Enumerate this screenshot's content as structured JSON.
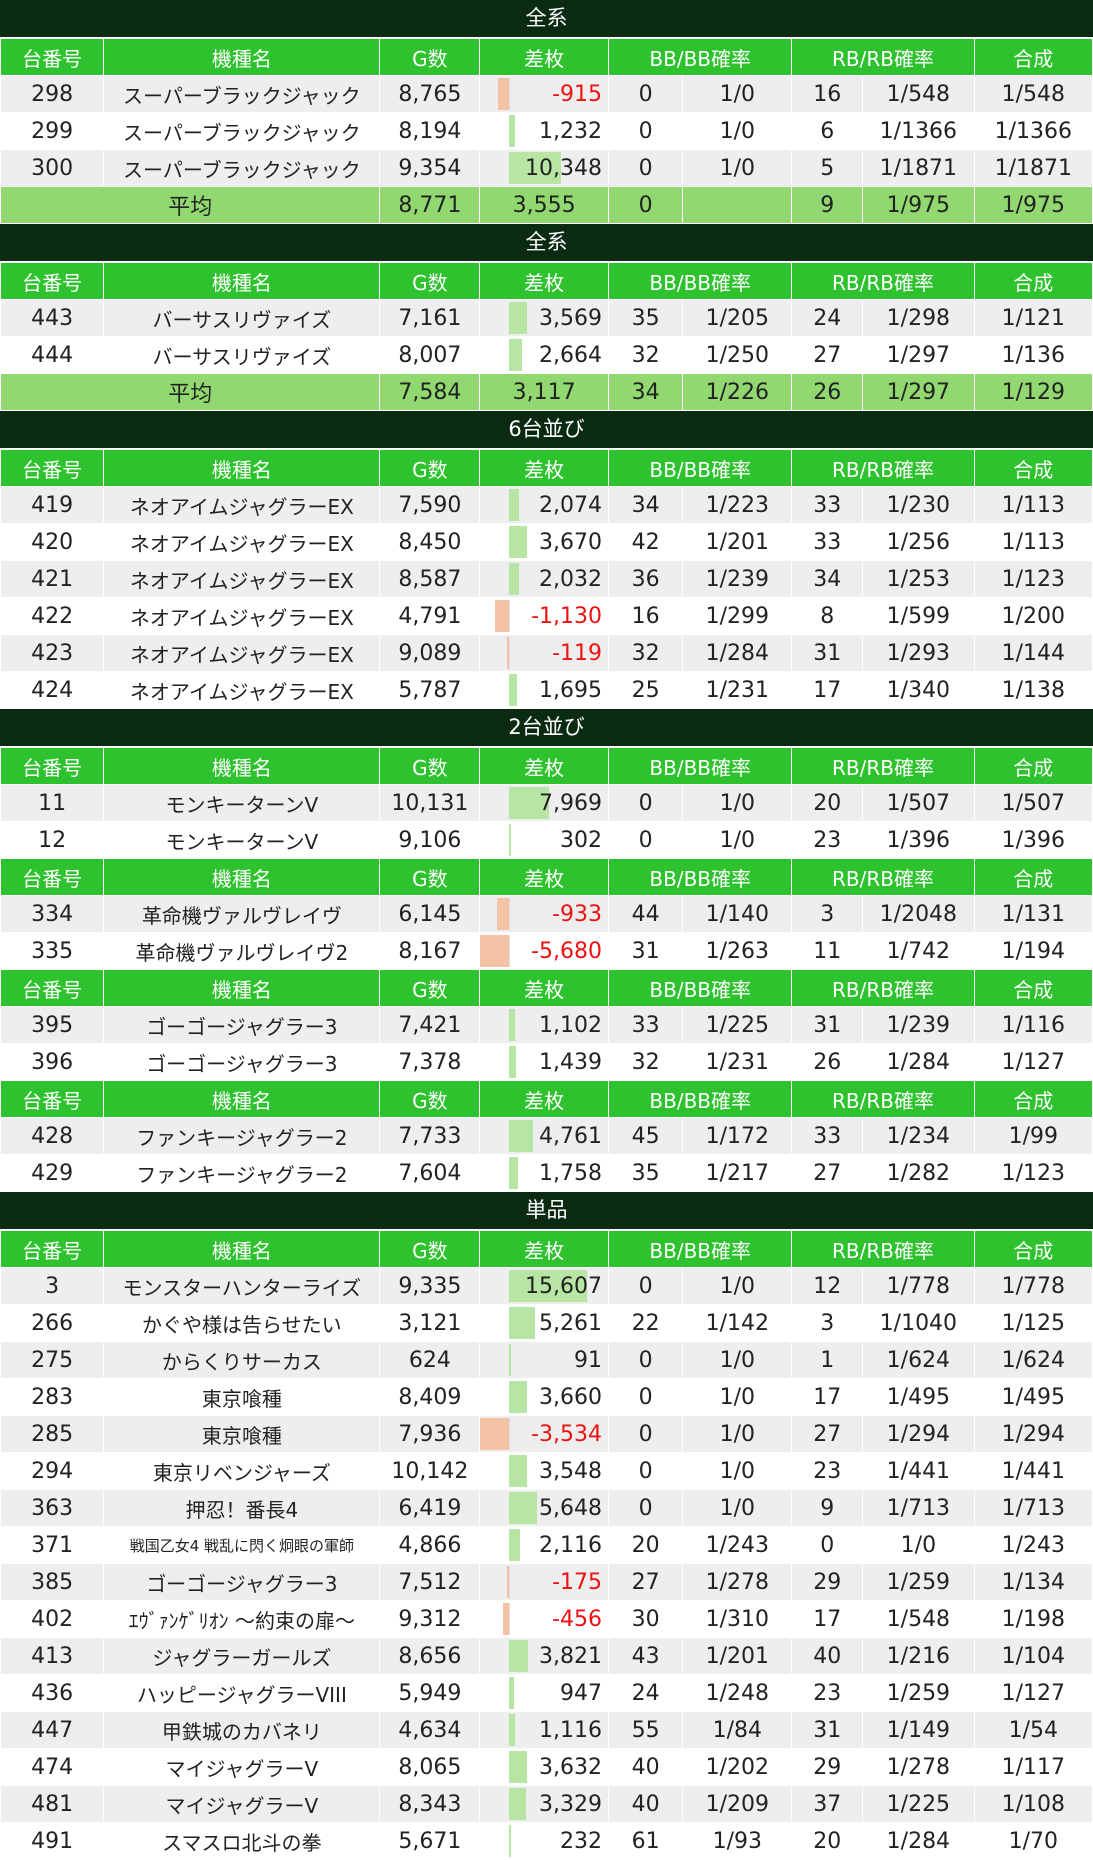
{
  "headers": [
    "台番号",
    "機種名",
    "G数",
    "差枚",
    "BB/BB確率",
    "",
    "RB/RB確率",
    "",
    "合成"
  ],
  "avg_label": "平均",
  "bar_scale_max": 15607,
  "colors": {
    "section_bg": "#0b2a12",
    "header_bg": "#2ec22e",
    "avg_bg": "#92d870",
    "positive_bar": "#b7e6a4",
    "negative_bar": "#f4c2a4",
    "negative_text": "#ee1111"
  },
  "sections": [
    {
      "title": "全系",
      "groups": [
        {
          "rows": [
            {
              "no": "298",
              "name": "スーパーブラックジャック",
              "games": "8,765",
              "diff": "-915",
              "diff_value": -915,
              "bb": "0",
              "bb_rate": "1/0",
              "rb": "16",
              "rb_rate": "1/548",
              "total": "1/548"
            },
            {
              "no": "299",
              "name": "スーパーブラックジャック",
              "games": "8,194",
              "diff": "1,232",
              "diff_value": 1232,
              "bb": "0",
              "bb_rate": "1/0",
              "rb": "6",
              "rb_rate": "1/1366",
              "total": "1/1366"
            },
            {
              "no": "300",
              "name": "スーパーブラックジャック",
              "games": "9,354",
              "diff": "10,348",
              "diff_value": 10348,
              "bb": "0",
              "bb_rate": "1/0",
              "rb": "5",
              "rb_rate": "1/1871",
              "total": "1/1871"
            }
          ],
          "avg": {
            "games": "8,771",
            "diff": "3,555",
            "bb": "0",
            "bb_rate": "",
            "rb": "9",
            "rb_rate": "1/975",
            "total": "1/975"
          }
        }
      ]
    },
    {
      "title": "全系",
      "groups": [
        {
          "rows": [
            {
              "no": "443",
              "name": "バーサスリヴァイズ",
              "games": "7,161",
              "diff": "3,569",
              "diff_value": 3569,
              "bb": "35",
              "bb_rate": "1/205",
              "rb": "24",
              "rb_rate": "1/298",
              "total": "1/121"
            },
            {
              "no": "444",
              "name": "バーサスリヴァイズ",
              "games": "8,007",
              "diff": "2,664",
              "diff_value": 2664,
              "bb": "32",
              "bb_rate": "1/250",
              "rb": "27",
              "rb_rate": "1/297",
              "total": "1/136"
            }
          ],
          "avg": {
            "games": "7,584",
            "diff": "3,117",
            "bb": "34",
            "bb_rate": "1/226",
            "rb": "26",
            "rb_rate": "1/297",
            "total": "1/129"
          }
        }
      ]
    },
    {
      "title": "6台並び",
      "groups": [
        {
          "rows": [
            {
              "no": "419",
              "name": "ネオアイムジャグラーEX",
              "games": "7,590",
              "diff": "2,074",
              "diff_value": 2074,
              "bb": "34",
              "bb_rate": "1/223",
              "rb": "33",
              "rb_rate": "1/230",
              "total": "1/113"
            },
            {
              "no": "420",
              "name": "ネオアイムジャグラーEX",
              "games": "8,450",
              "diff": "3,670",
              "diff_value": 3670,
              "bb": "42",
              "bb_rate": "1/201",
              "rb": "33",
              "rb_rate": "1/256",
              "total": "1/113"
            },
            {
              "no": "421",
              "name": "ネオアイムジャグラーEX",
              "games": "8,587",
              "diff": "2,032",
              "diff_value": 2032,
              "bb": "36",
              "bb_rate": "1/239",
              "rb": "34",
              "rb_rate": "1/253",
              "total": "1/123"
            },
            {
              "no": "422",
              "name": "ネオアイムジャグラーEX",
              "games": "4,791",
              "diff": "-1,130",
              "diff_value": -1130,
              "bb": "16",
              "bb_rate": "1/299",
              "rb": "8",
              "rb_rate": "1/599",
              "total": "1/200"
            },
            {
              "no": "423",
              "name": "ネオアイムジャグラーEX",
              "games": "9,089",
              "diff": "-119",
              "diff_value": -119,
              "bb": "32",
              "bb_rate": "1/284",
              "rb": "31",
              "rb_rate": "1/293",
              "total": "1/144"
            },
            {
              "no": "424",
              "name": "ネオアイムジャグラーEX",
              "games": "5,787",
              "diff": "1,695",
              "diff_value": 1695,
              "bb": "25",
              "bb_rate": "1/231",
              "rb": "17",
              "rb_rate": "1/340",
              "total": "1/138"
            }
          ]
        }
      ]
    },
    {
      "title": "2台並び",
      "groups": [
        {
          "rows": [
            {
              "no": "11",
              "name": "モンキーターンV",
              "games": "10,131",
              "diff": "7,969",
              "diff_value": 7969,
              "bb": "0",
              "bb_rate": "1/0",
              "rb": "20",
              "rb_rate": "1/507",
              "total": "1/507"
            },
            {
              "no": "12",
              "name": "モンキーターンV",
              "games": "9,106",
              "diff": "302",
              "diff_value": 302,
              "bb": "0",
              "bb_rate": "1/0",
              "rb": "23",
              "rb_rate": "1/396",
              "total": "1/396"
            }
          ]
        },
        {
          "rows": [
            {
              "no": "334",
              "name": "革命機ヴァルヴレイヴ",
              "games": "6,145",
              "diff": "-933",
              "diff_value": -933,
              "bb": "44",
              "bb_rate": "1/140",
              "rb": "3",
              "rb_rate": "1/2048",
              "total": "1/131"
            },
            {
              "no": "335",
              "name": "革命機ヴァルヴレイヴ2",
              "games": "8,167",
              "diff": "-5,680",
              "diff_value": -5680,
              "bb": "31",
              "bb_rate": "1/263",
              "rb": "11",
              "rb_rate": "1/742",
              "total": "1/194"
            }
          ]
        },
        {
          "rows": [
            {
              "no": "395",
              "name": "ゴーゴージャグラー3",
              "games": "7,421",
              "diff": "1,102",
              "diff_value": 1102,
              "bb": "33",
              "bb_rate": "1/225",
              "rb": "31",
              "rb_rate": "1/239",
              "total": "1/116"
            },
            {
              "no": "396",
              "name": "ゴーゴージャグラー3",
              "games": "7,378",
              "diff": "1,439",
              "diff_value": 1439,
              "bb": "32",
              "bb_rate": "1/231",
              "rb": "26",
              "rb_rate": "1/284",
              "total": "1/127"
            }
          ]
        },
        {
          "rows": [
            {
              "no": "428",
              "name": "ファンキージャグラー2",
              "games": "7,733",
              "diff": "4,761",
              "diff_value": 4761,
              "bb": "45",
              "bb_rate": "1/172",
              "rb": "33",
              "rb_rate": "1/234",
              "total": "1/99"
            },
            {
              "no": "429",
              "name": "ファンキージャグラー2",
              "games": "7,604",
              "diff": "1,758",
              "diff_value": 1758,
              "bb": "35",
              "bb_rate": "1/217",
              "rb": "27",
              "rb_rate": "1/282",
              "total": "1/123"
            }
          ]
        }
      ]
    },
    {
      "title": "単品",
      "groups": [
        {
          "rows": [
            {
              "no": "3",
              "name": "モンスターハンターライズ",
              "games": "9,335",
              "diff": "15,607",
              "diff_value": 15607,
              "bb": "0",
              "bb_rate": "1/0",
              "rb": "12",
              "rb_rate": "1/778",
              "total": "1/778"
            },
            {
              "no": "266",
              "name": "かぐや様は告らせたい",
              "games": "3,121",
              "diff": "5,261",
              "diff_value": 5261,
              "bb": "22",
              "bb_rate": "1/142",
              "rb": "3",
              "rb_rate": "1/1040",
              "total": "1/125"
            },
            {
              "no": "275",
              "name": "からくりサーカス",
              "games": "624",
              "diff": "91",
              "diff_value": 91,
              "bb": "0",
              "bb_rate": "1/0",
              "rb": "1",
              "rb_rate": "1/624",
              "total": "1/624"
            },
            {
              "no": "283",
              "name": "東京喰種",
              "games": "8,409",
              "diff": "3,660",
              "diff_value": 3660,
              "bb": "0",
              "bb_rate": "1/0",
              "rb": "17",
              "rb_rate": "1/495",
              "total": "1/495"
            },
            {
              "no": "285",
              "name": "東京喰種",
              "games": "7,936",
              "diff": "-3,534",
              "diff_value": -3534,
              "bb": "0",
              "bb_rate": "1/0",
              "rb": "27",
              "rb_rate": "1/294",
              "total": "1/294"
            },
            {
              "no": "294",
              "name": "東京リベンジャーズ",
              "games": "10,142",
              "diff": "3,548",
              "diff_value": 3548,
              "bb": "0",
              "bb_rate": "1/0",
              "rb": "23",
              "rb_rate": "1/441",
              "total": "1/441"
            },
            {
              "no": "363",
              "name": "押忍！番長4",
              "games": "6,419",
              "diff": "5,648",
              "diff_value": 5648,
              "bb": "0",
              "bb_rate": "1/0",
              "rb": "9",
              "rb_rate": "1/713",
              "total": "1/713"
            },
            {
              "no": "371",
              "name": "戦国乙女4 戦乱に閃く炯眼の軍師",
              "small": true,
              "games": "4,866",
              "diff": "2,116",
              "diff_value": 2116,
              "bb": "20",
              "bb_rate": "1/243",
              "rb": "0",
              "rb_rate": "1/0",
              "total": "1/243"
            },
            {
              "no": "385",
              "name": "ゴーゴージャグラー3",
              "games": "7,512",
              "diff": "-175",
              "diff_value": -175,
              "bb": "27",
              "bb_rate": "1/278",
              "rb": "29",
              "rb_rate": "1/259",
              "total": "1/134"
            },
            {
              "no": "402",
              "name": "ｴｳﾞｧﾝｹﾞﾘｵﾝ ～約束の扉～",
              "games": "9,312",
              "diff": "-456",
              "diff_value": -456,
              "bb": "30",
              "bb_rate": "1/310",
              "rb": "17",
              "rb_rate": "1/548",
              "total": "1/198"
            },
            {
              "no": "413",
              "name": "ジャグラーガールズ",
              "games": "8,656",
              "diff": "3,821",
              "diff_value": 3821,
              "bb": "43",
              "bb_rate": "1/201",
              "rb": "40",
              "rb_rate": "1/216",
              "total": "1/104"
            },
            {
              "no": "436",
              "name": "ハッピージャグラーVIII",
              "games": "5,949",
              "diff": "947",
              "diff_value": 947,
              "bb": "24",
              "bb_rate": "1/248",
              "rb": "23",
              "rb_rate": "1/259",
              "total": "1/127"
            },
            {
              "no": "447",
              "name": "甲鉄城のカバネリ",
              "games": "4,634",
              "diff": "1,116",
              "diff_value": 1116,
              "bb": "55",
              "bb_rate": "1/84",
              "rb": "31",
              "rb_rate": "1/149",
              "total": "1/54"
            },
            {
              "no": "474",
              "name": "マイジャグラーV",
              "games": "8,065",
              "diff": "3,632",
              "diff_value": 3632,
              "bb": "40",
              "bb_rate": "1/202",
              "rb": "29",
              "rb_rate": "1/278",
              "total": "1/117"
            },
            {
              "no": "481",
              "name": "マイジャグラーV",
              "games": "8,343",
              "diff": "3,329",
              "diff_value": 3329,
              "bb": "40",
              "bb_rate": "1/209",
              "rb": "37",
              "rb_rate": "1/225",
              "total": "1/108"
            },
            {
              "no": "491",
              "name": "スマスロ北斗の拳",
              "games": "5,671",
              "diff": "232",
              "diff_value": 232,
              "bb": "61",
              "bb_rate": "1/93",
              "rb": "20",
              "rb_rate": "1/284",
              "total": "1/70"
            }
          ]
        }
      ]
    }
  ]
}
